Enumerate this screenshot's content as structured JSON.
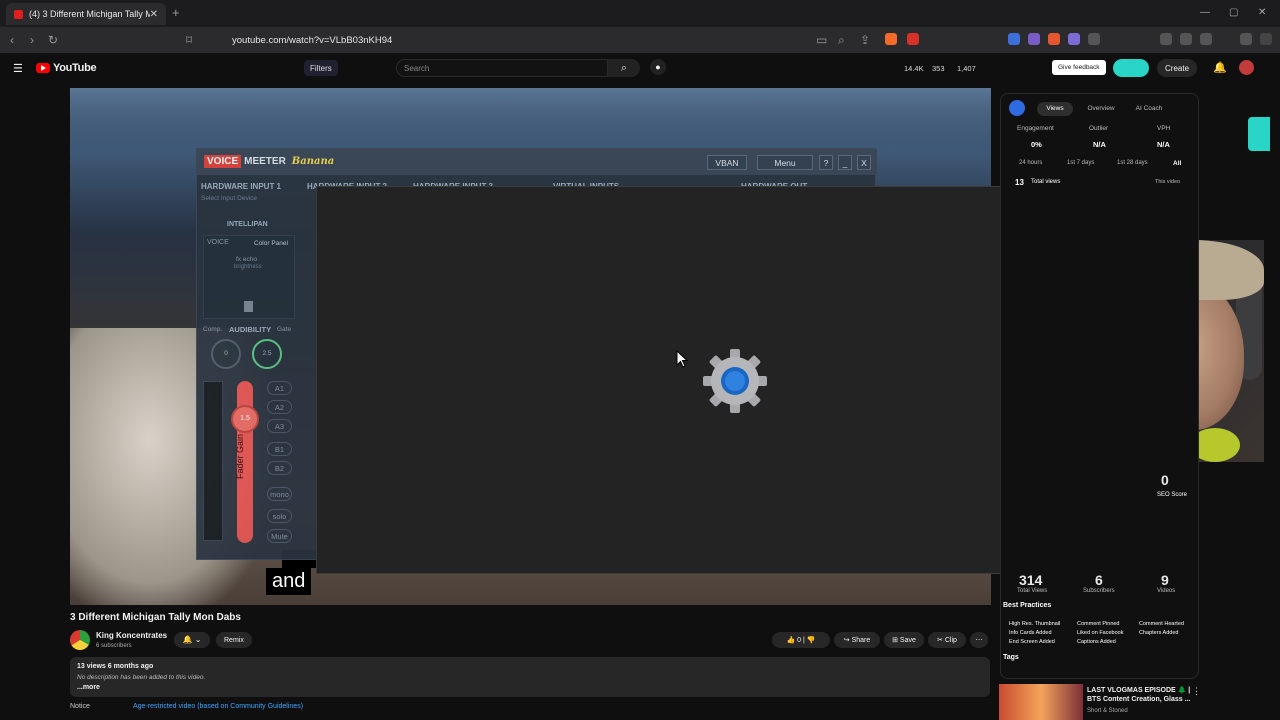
{
  "browser": {
    "tab_title": "(4) 3 Different Michigan Tally M",
    "url": "youtube.com/watch?v=VLbB03nKH94"
  },
  "yt": {
    "logo": "YouTube",
    "filters": "Filters",
    "search_placeholder": "Search",
    "stats": [
      "14.4K",
      "353",
      "1,407"
    ],
    "feedback": "Give feedback",
    "create": "Create",
    "notif_count": "4"
  },
  "voicemeeter": {
    "brand_a": "VOICE",
    "brand_b": "MEETER",
    "brand_c": "Banana",
    "vban": "VBAN",
    "menu": "Menu",
    "help": "?",
    "min": "_",
    "close": "X",
    "hw1": "HARDWARE INPUT 1",
    "hw2": "HARDWARE INPUT 2",
    "hw3": "HARDWARE INPUT 3",
    "virt": "VIRTUAL INPUTS",
    "hwout": "HARDWARE OUT",
    "select": "Select Input Device",
    "intellipan": "INTELLIPAN",
    "voice": "VOICE",
    "color_panel": "Color Panel",
    "fx": "fx echo",
    "brightness": "brightness",
    "comp": "Comp.",
    "audibility": "AUDIBILITY",
    "gate": "Gate",
    "knob1": "0",
    "knob2": "2.5",
    "fader_value": "1.5",
    "fader_label": "Fader Gain",
    "buses": [
      "A1",
      "A2",
      "A3",
      "B1",
      "B2"
    ],
    "mono": "mono",
    "solo": "solo",
    "mute": "Mute"
  },
  "video": {
    "caption": "and",
    "title": "3 Different Michigan Tally Mon Dabs",
    "channel": "King Koncentrates",
    "subscribers": "6 subscribers",
    "remix": "Remix",
    "likes": "0",
    "share": "Share",
    "save": "Save",
    "clip": "Clip",
    "meta": "13 views  6 months ago",
    "no_desc": "No description has been added to this video.",
    "more": "...more",
    "notice": "Notice",
    "notice_link": "Age-restricted video (based on Community Guidelines)"
  },
  "vidiq": {
    "tabs": [
      "Views",
      "Overview",
      "AI Coach"
    ],
    "engagement": "Engagement",
    "outlier": "Outlier",
    "vph": "VPH",
    "engagement_val": "0%",
    "outlier_val": "N/A",
    "vph_val": "N/A",
    "ranges": [
      "24 hours",
      "1st 7 days",
      "1st 28 days",
      "All"
    ],
    "total_views_num": "13",
    "total_views_label": "Total views",
    "this_video": "This video",
    "seo_num": "0",
    "seo_label": "SEO Score",
    "channel_stats": [
      {
        "num": "314",
        "label": "Total Views"
      },
      {
        "num": "6",
        "label": "Subscribers"
      },
      {
        "num": "9",
        "label": "Videos"
      }
    ],
    "best_practices": "Best Practices",
    "bp_col1": [
      "High Res. Thumbnail",
      "Info Cards Added",
      "End Screen Added"
    ],
    "bp_col2": [
      "Comment Pinned",
      "Liked on Facebook",
      "Captions Added"
    ],
    "bp_col3": [
      "Comment Hearted",
      "Chapters Added"
    ],
    "tags": "Tags"
  },
  "suggestion": {
    "title": "LAST VLOGMAS EPISODE 🌲 | BTS Content Creation, Glass ...",
    "channel": "Short & Stoned"
  }
}
